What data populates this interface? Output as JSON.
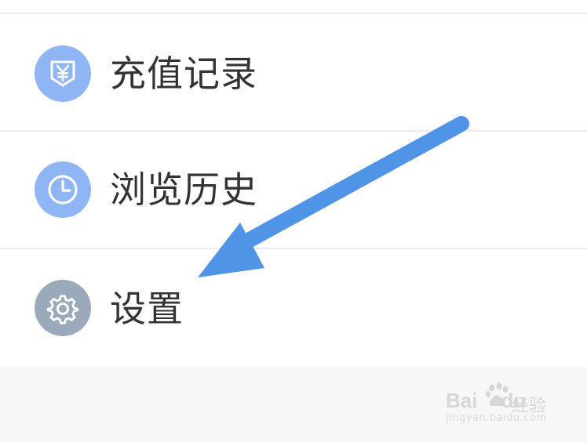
{
  "menu": {
    "items": [
      {
        "label": "充值记录",
        "icon": "yuan-shield-icon",
        "icon_color": "#8fb5f5"
      },
      {
        "label": "浏览历史",
        "icon": "clock-icon",
        "icon_color": "#8fb5f5"
      },
      {
        "label": "设置",
        "icon": "gear-icon",
        "icon_color": "#9aaabb"
      }
    ]
  },
  "annotation": {
    "arrow_color": "#5094e8",
    "arrow_icon": "arrow-annotation-icon"
  },
  "watermark": {
    "brand": "Bai",
    "brand_suffix": "du",
    "brand_cn": "经验",
    "url": "jingyan.baidu.com"
  },
  "colors": {
    "background": "#ffffff",
    "divider": "#ececec",
    "footer_background": "#f7f7f8",
    "label_text": "#333333"
  }
}
